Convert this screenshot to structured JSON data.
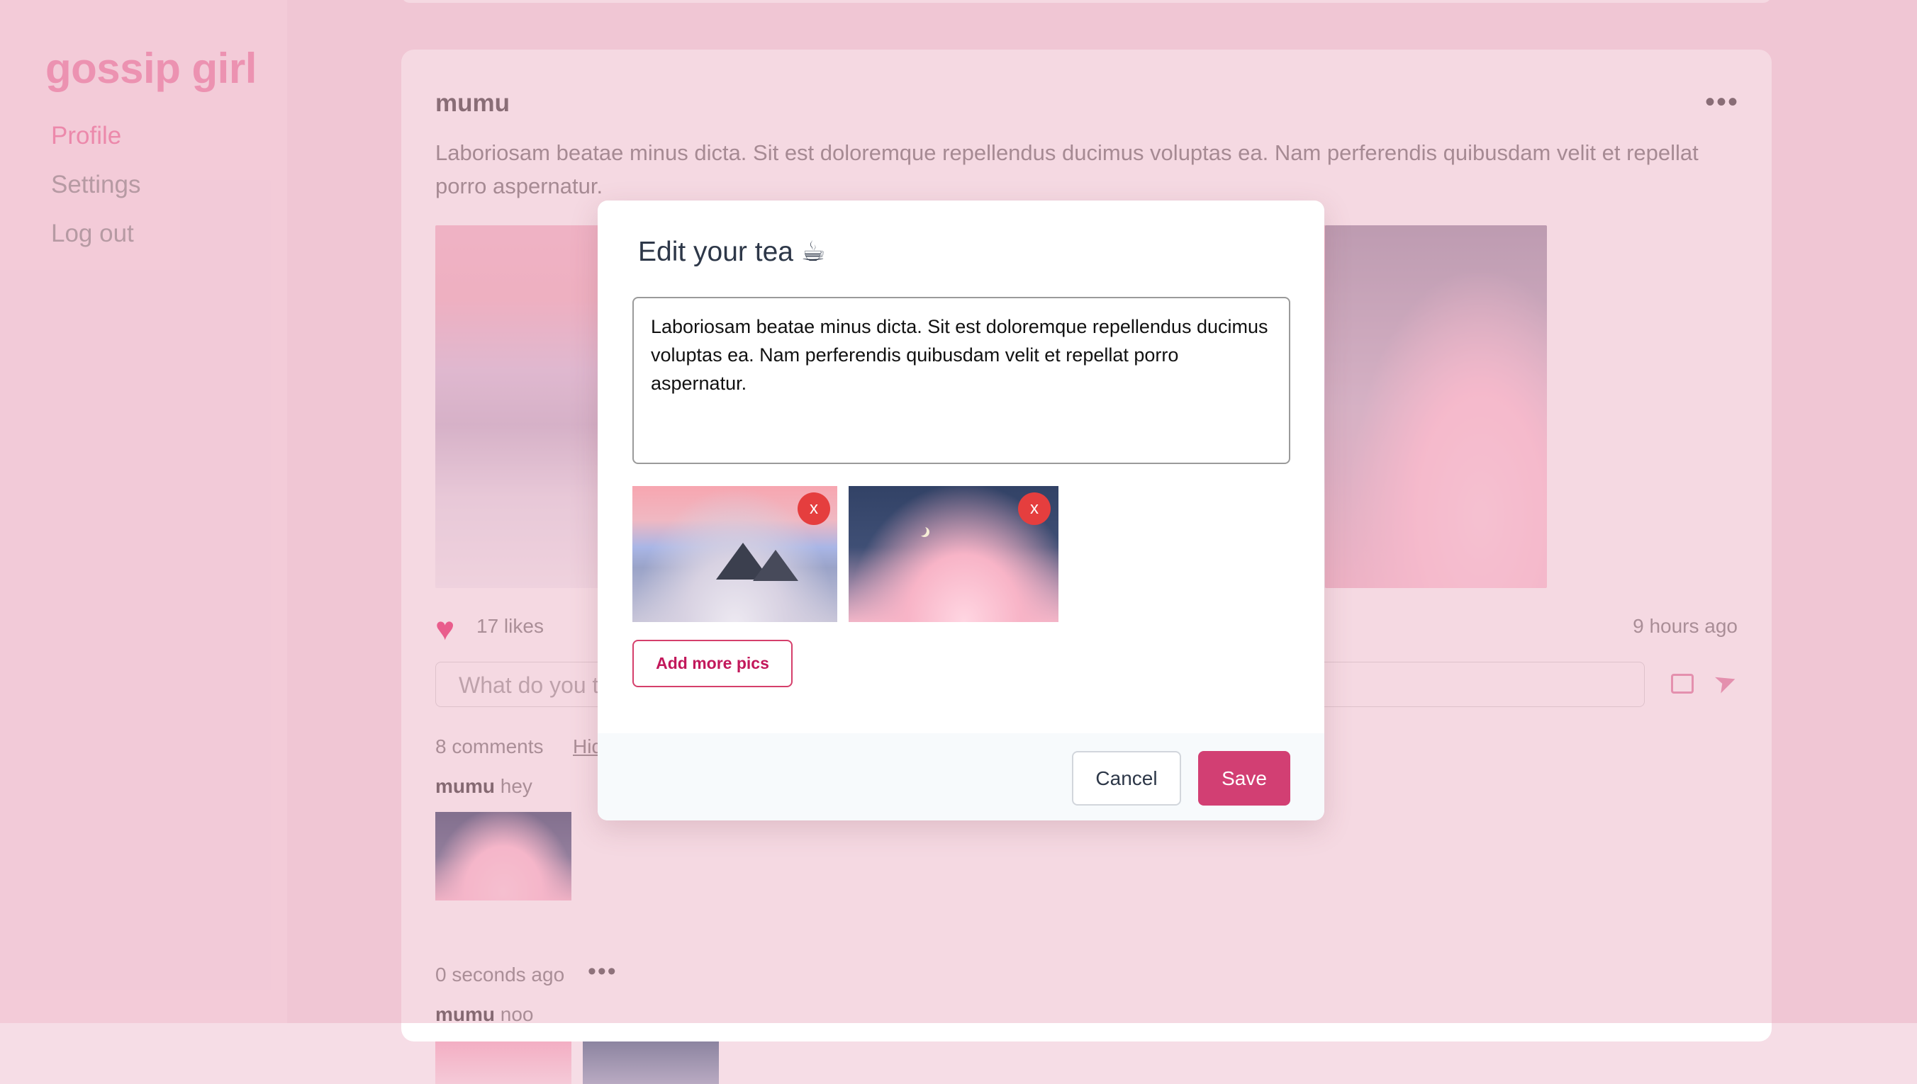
{
  "sidebar": {
    "logo": "gossip girl",
    "nav": [
      {
        "label": "Profile"
      },
      {
        "label": "Settings"
      },
      {
        "label": "Log out"
      }
    ]
  },
  "post": {
    "author": "mumu",
    "more": "•••",
    "text": "Laboriosam beatae minus dicta. Sit est doloremque repellendus ducimus voluptas ea. Nam perferendis quibusdam velit et repellat porro aspernatur.",
    "likes": "17 likes",
    "time": "9 hours ago",
    "comment_placeholder": "What do you think?",
    "comments_count": "8 comments",
    "hide_comments": "Hide comments",
    "comments": [
      {
        "author": "mumu",
        "text": "hey",
        "time": "0 seconds ago"
      },
      {
        "author": "mumu",
        "text": "noo"
      }
    ]
  },
  "modal": {
    "title": "Edit your tea ☕",
    "textarea_value": "Laboriosam beatae minus dicta. Sit est doloremque repellendus ducimus voluptas ea. Nam perferendis quibusdam velit et repellat porro aspernatur.",
    "remove_label": "x",
    "add_pics_label": "Add more pics",
    "cancel_label": "Cancel",
    "save_label": "Save"
  },
  "icons": {
    "more": "more-dots-icon",
    "heart": "heart-icon",
    "image_upload": "image-upload-icon",
    "send": "send-icon",
    "remove": "remove-x-icon"
  },
  "colors": {
    "accent": "#d23f73",
    "logo": "#ee7ea7",
    "remove_button": "#e53e3e",
    "overlay": "#f0c6d4"
  }
}
